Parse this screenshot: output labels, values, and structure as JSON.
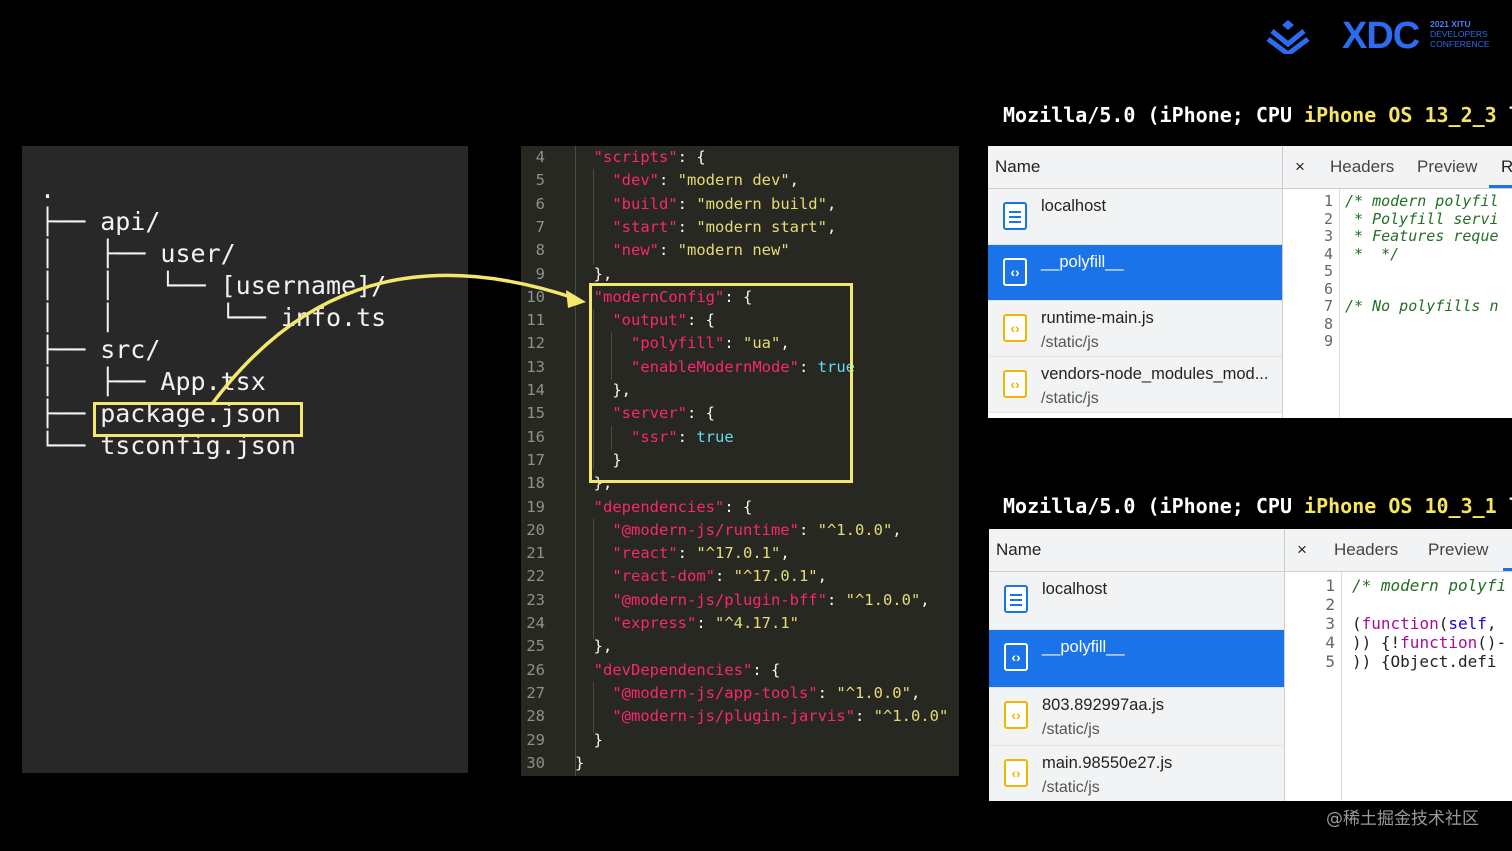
{
  "logo": {
    "text": "XDC",
    "line1": "2021 XITU",
    "line2": "DEVELOPERS",
    "line3": "CONFERENCE"
  },
  "tree": {
    "lines": [
      ".",
      "├── api/",
      "│   ├── user/",
      "│   │   └── [username]/",
      "│   │       └── info.ts",
      "├── src/",
      "│   ├── App.tsx",
      "├── package.json",
      "└── tsconfig.json"
    ]
  },
  "code": {
    "line_numbers": [
      "4",
      "5",
      "6",
      "7",
      "8",
      "9",
      "10",
      "11",
      "12",
      "13",
      "14",
      "15",
      "16",
      "17",
      "18",
      "19",
      "20",
      "21",
      "22",
      "23",
      "24",
      "25",
      "26",
      "27",
      "28",
      "29",
      "30"
    ]
  },
  "panel1": {
    "ua_prefix": "Mozilla/5.0 (iPhone; CPU ",
    "ua_highlight": "iPhone OS 13_2_3",
    "ua_suffix": " l",
    "name_header": "Name",
    "items": [
      {
        "name": "localhost",
        "path": ""
      },
      {
        "name": "__polyfill__",
        "path": ""
      },
      {
        "name": "runtime-main.js",
        "path": "/static/js"
      },
      {
        "name": "vendors-node_modules_mod...",
        "path": "/static/js"
      }
    ],
    "tabs": {
      "close": "×",
      "headers": "Headers",
      "preview": "Preview",
      "response": "R"
    },
    "gutter": [
      "1",
      "2",
      "3",
      "4",
      "5",
      "6",
      "7",
      "8",
      "9"
    ],
    "code_lines": [
      "/* modern polyfil",
      " * Polyfill servi",
      " * Features reque",
      " *  */",
      "",
      "",
      "/* No polyfills n",
      "",
      ""
    ]
  },
  "panel2": {
    "ua_prefix": "Mozilla/5.0 (iPhone; CPU ",
    "ua_highlight": "iPhone OS 10_3_1",
    "ua_suffix": " l",
    "name_header": "Name",
    "items": [
      {
        "name": "localhost",
        "path": ""
      },
      {
        "name": "__polyfill__",
        "path": ""
      },
      {
        "name": "803.892997aa.js",
        "path": "/static/js"
      },
      {
        "name": "main.98550e27.js",
        "path": "/static/js"
      }
    ],
    "tabs": {
      "close": "×",
      "headers": "Headers",
      "preview": "Preview"
    },
    "gutter": [
      "1",
      "2",
      "3",
      "4",
      "5"
    ],
    "code": {
      "l1": "/* modern polyfi",
      "l3_a": "(",
      "l3_kw": "function",
      "l3_b": "(",
      "l3_id": "self",
      "l3_c": ",",
      "l4_a": ")) {!",
      "l4_kw": "function",
      "l4_b": "()-",
      "l5": ")) {Object.defi"
    }
  },
  "watermark": "@稀土掘金技术社区",
  "colors": {
    "highlight_box": "#f3e86c",
    "selected_row": "#1a73e8",
    "brand": "#2d6bf0"
  }
}
